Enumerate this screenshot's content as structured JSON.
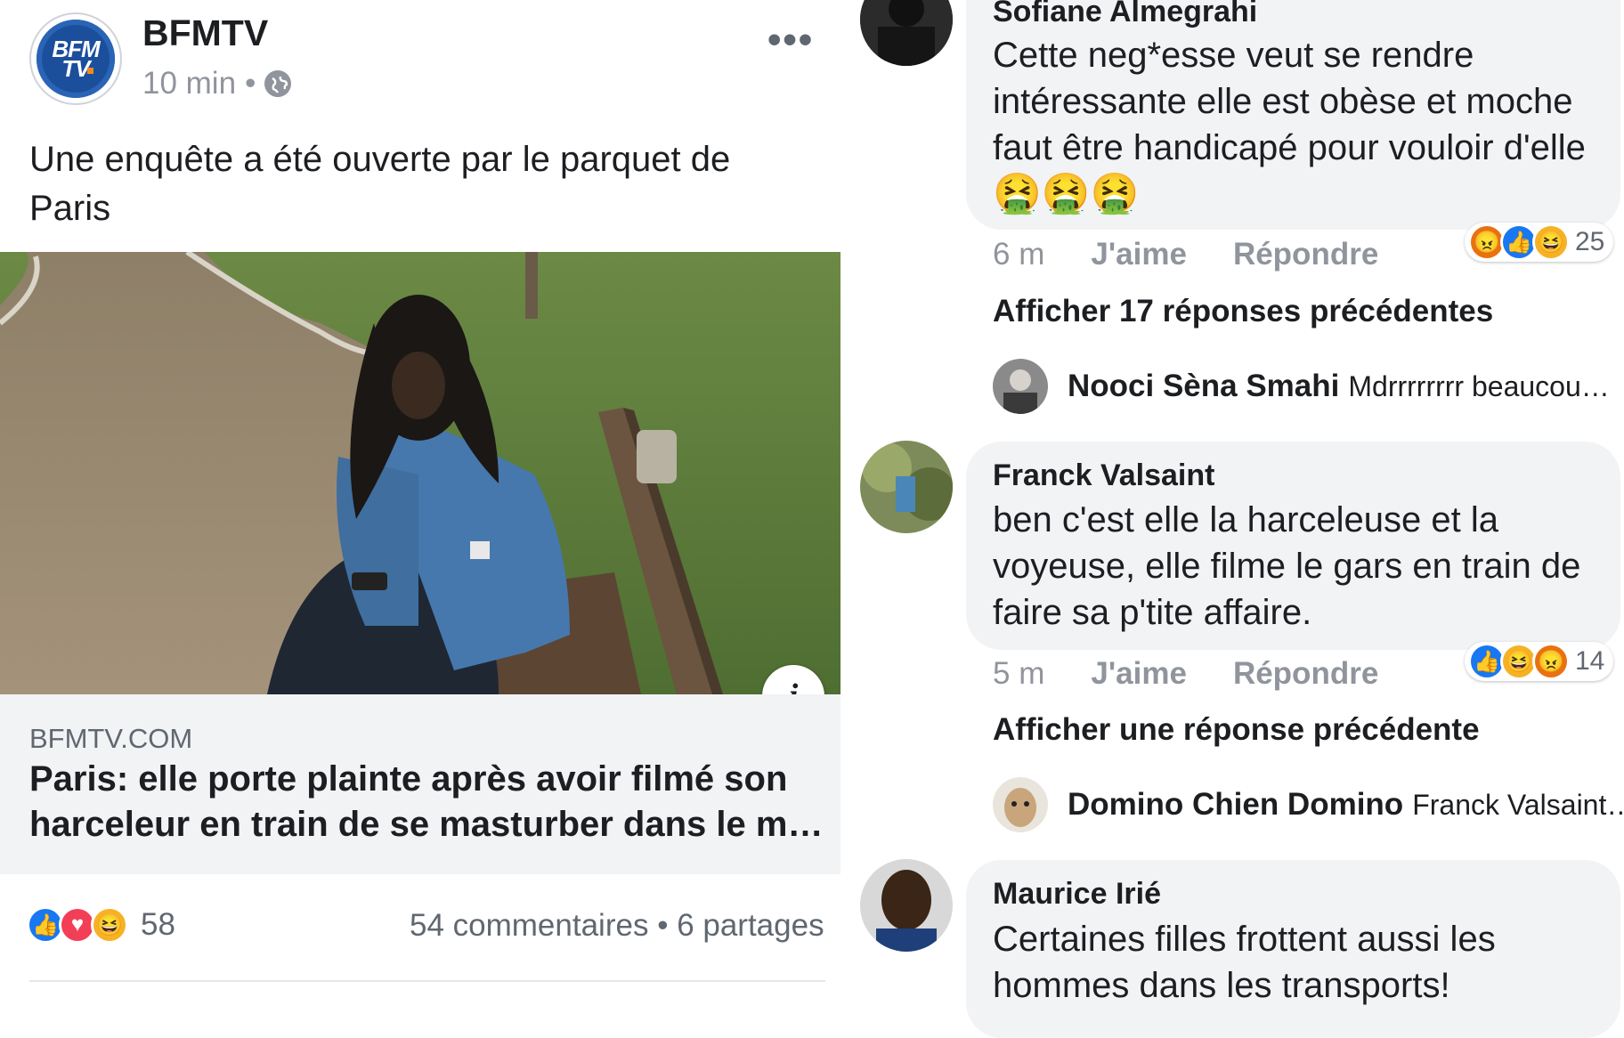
{
  "post": {
    "page_name": "BFMTV",
    "logo_text_line1": "BFM",
    "logo_text_line2": "TV",
    "time": "10 min",
    "meta_separator": "•",
    "audience_icon": "globe-icon",
    "more_icon": "more-dots-icon",
    "more_label": "•••",
    "text": "Une enquête a été ouverte par le parquet de Paris",
    "info_label": "i",
    "link": {
      "domain": "BFMTV.COM",
      "title_line1": "Paris: elle porte plainte après avoir filmé son",
      "title_line2": "harceleur en train de se masturber dans le m…"
    },
    "reactions": {
      "icons": [
        "like-icon",
        "love-icon",
        "haha-icon"
      ],
      "count": "58"
    },
    "comments_count": "54 commentaires",
    "shares_count": "6 partages",
    "counts_separator": "•"
  },
  "comments": [
    {
      "name": "Sofiane Almegrahi",
      "text": "Cette neg*esse veut se rendre intéressante elle est obèse et moche faut être handicapé pour vouloir d'elle",
      "emoji": "🤮🤮🤮",
      "time": "6 m",
      "like_label": "J'aime",
      "reply_label": "Répondre",
      "reactions": {
        "icons": [
          "angry-icon",
          "like-icon",
          "haha-icon"
        ],
        "count": "25"
      },
      "view_more": "Afficher 17 réponses précédentes",
      "latest_reply": {
        "name": "Nooci Sèna Smahi",
        "text": "Mdrrrrrrrr beaucou…"
      }
    },
    {
      "name": "Franck Valsaint",
      "text": "ben c'est elle la harceleuse et la voyeuse, elle filme le gars en train de faire sa p'tite affaire.",
      "time": "5 m",
      "like_label": "J'aime",
      "reply_label": "Répondre",
      "reactions": {
        "icons": [
          "like-icon",
          "haha-icon",
          "angry-icon"
        ],
        "count": "14"
      },
      "view_more": "Afficher une réponse précédente",
      "latest_reply": {
        "name": "Domino Chien Domino",
        "text": "Franck Valsaint…"
      }
    },
    {
      "name": "Maurice Irié",
      "text": "Certaines filles frottent aussi les hommes dans les transports!"
    }
  ],
  "colors": {
    "brand_blue": "#1b4f9c",
    "like_blue": "#1877f2",
    "love_red": "#f33e58",
    "haha_yellow": "#f7b125",
    "angry_orange": "#e9710f",
    "bubble_gray": "#f2f3f5",
    "meta_gray": "#90949c"
  }
}
